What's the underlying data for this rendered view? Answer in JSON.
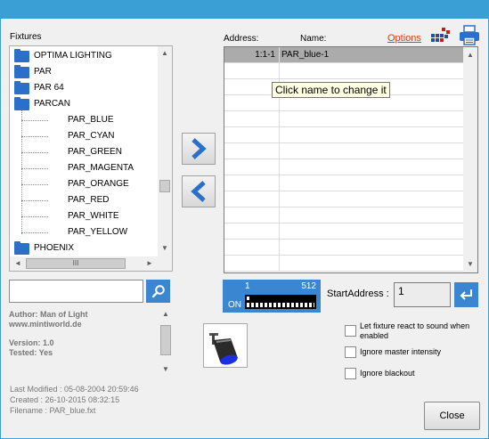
{
  "fixtures_label": "Fixtures",
  "tree": {
    "folders_top": [
      "OPTIMA LIGHTING",
      "PAR",
      "PAR 64",
      "PARCAN"
    ],
    "children": [
      "PAR_BLUE",
      "PAR_CYAN",
      "PAR_GREEN",
      "PAR_MAGENTA",
      "PAR_ORANGE",
      "PAR_RED",
      "PAR_WHITE",
      "PAR_YELLOW"
    ],
    "folder_bottom": "PHOENIX",
    "hscroll_grip": "III"
  },
  "search": {
    "value": "",
    "placeholder": ""
  },
  "info": {
    "author": "Author: Man of Light",
    "website": "www.mintiworld.de",
    "version": "Version: 1.0",
    "tested": "Tested: Yes"
  },
  "meta": {
    "last_modified": "Last Modified : 05-08-2004 20:59:46",
    "created": "Created : 26-10-2015 08:32:15",
    "filename": "Filename : PAR_blue.fxt"
  },
  "address_label": "Address:",
  "name_label": "Name:",
  "options_link": "Options",
  "grid": {
    "rows": [
      {
        "address": "1:1-1",
        "name": "PAR_blue-1"
      }
    ],
    "tooltip": "Click name to change it",
    "empty_rows": 13
  },
  "dmx": {
    "start": "1",
    "end": "512",
    "on": "ON",
    "fill_fraction": 0.04
  },
  "start_address": {
    "label": "StartAddress :",
    "value": "1"
  },
  "checkboxes": [
    {
      "label": "Let fixture react to sound when enabled",
      "checked": false
    },
    {
      "label": "Ignore master intensity",
      "checked": false
    },
    {
      "label": "Ignore blackout",
      "checked": false
    }
  ],
  "close_label": "Close",
  "colors": {
    "title_bar": "#3a9fd5",
    "accent": "#3a86d0",
    "folder": "#2a6fca",
    "link": "#d04010"
  }
}
